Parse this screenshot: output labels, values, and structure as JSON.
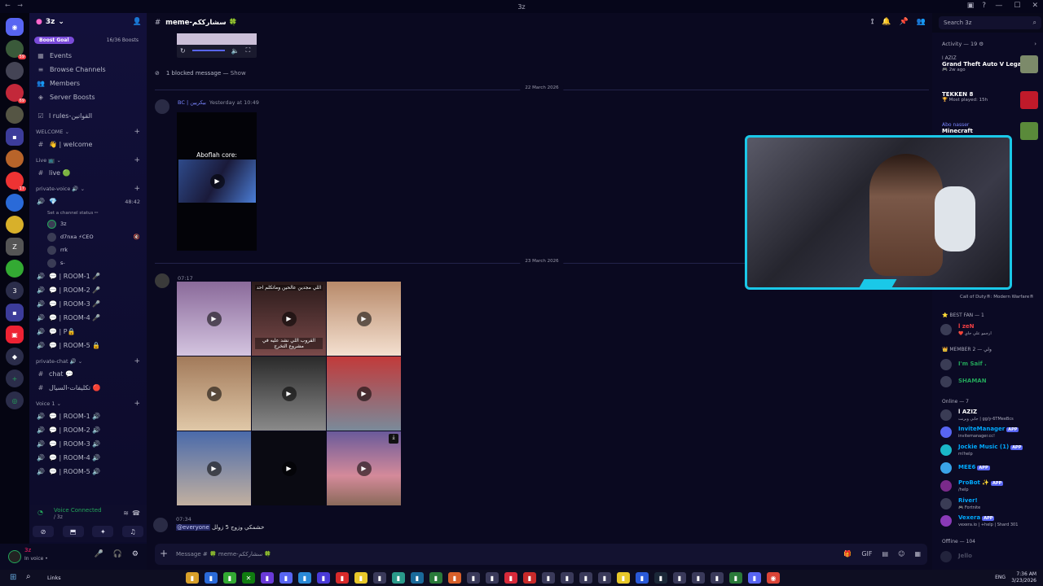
{
  "window": {
    "title": "3z"
  },
  "guild_badges": [
    "",
    "59",
    "",
    "69",
    "",
    "",
    "",
    "17",
    "",
    "3",
    "",
    "",
    ""
  ],
  "server": {
    "name": "3z",
    "boost_label": "Boost Goal",
    "boost_count": "16/36 Boosts"
  },
  "nav": [
    {
      "label": "Events",
      "icon": "calendar-icon"
    },
    {
      "label": "Browse Channels",
      "icon": "browse-icon"
    },
    {
      "label": "Members",
      "icon": "members-icon"
    },
    {
      "label": "Server Boosts",
      "icon": "boost-icon"
    }
  ],
  "rules_channel": "ا rules-القوانين",
  "categories": {
    "welcome": "WELCOME",
    "live": "Live 📺",
    "private_voice": "private-voice 🔊",
    "private_chat": "private-chat 🔊",
    "voice": "Voice 1"
  },
  "channels": {
    "welcome": "👋 | welcome",
    "live": "live 🟢",
    "private_voice_channel": "💎",
    "private_voice_time": "48:42",
    "channel_status": "Set a channel status ✏",
    "voice_users": [
      {
        "name": "3z"
      },
      {
        "name": "d7nxa ⚡CEO"
      },
      {
        "name": "rrk"
      },
      {
        "name": "s-"
      }
    ],
    "rooms": [
      "💬 | ROOM-1 🎤",
      "💬 | ROOM-2 🎤",
      "💬 | ROOM-3 🎤",
      "💬 | ROOM-4 🎤",
      "💬 | P🔒",
      "💬 | ROOM-5 🔒"
    ],
    "chat": [
      "chat 💬",
      "تكليفات-السيال 🔴"
    ],
    "voice_rooms": [
      "💬 | ROOM-1 🔊",
      "💬 | ROOM-2 🔊",
      "💬 | ROOM-3 🔊",
      "💬 | ROOM-4 🔊",
      "💬 | ROOM-5 🔊"
    ]
  },
  "voice_panel": {
    "status": "Voice Connected",
    "sub": "/ 3z"
  },
  "user_panel": {
    "name": "3z",
    "status": "In voice •"
  },
  "channel_header": {
    "name": "meme-سشارككم 🍀"
  },
  "messages": {
    "blocked": "1 blocked message —",
    "blocked_show": "Show",
    "date1": "22 March 2026",
    "author1": "BC | بيكريين",
    "time1": "Yesterday at 10:49",
    "video_title": "Aboflah core:",
    "date2": "23 March 2026",
    "time2": "07:17",
    "captions": [
      "اللي مجدين عالحين وماتكلم احد",
      "القروب اللي نشد عليه في مشروع التخرج"
    ],
    "last_time": "07:34",
    "mention": "@everyone",
    "last_text": "خشمكي وزوج 5 زولل"
  },
  "composer": {
    "placeholder": "Message # 🍀 meme-سشارككم 🍀"
  },
  "search": {
    "placeholder": "Search 3z"
  },
  "activity": {
    "header": "Activity — 19 ⚙",
    "items": [
      {
        "user": "ا AZIZ",
        "game": "Grand Theft Auto V Legacy",
        "time": "🎮 2w ago",
        "color": "#7c8a6a"
      },
      {
        "user": "",
        "game": "TEKKEN 8",
        "time": "🏆 Most played: 15h",
        "color": "#c01a2a"
      },
      {
        "user": "Abo nasser",
        "game": "Minecraft",
        "time": "",
        "color": "#5a8a3a"
      }
    ],
    "cod": "Call of Duty®: Modern Warfare®"
  },
  "member_sections": {
    "best_fan": "⭐ BEST FAN — 1",
    "member": "👑 MEMBER ولي — 2",
    "online": "Online — 7",
    "offline": "Offline — 104"
  },
  "members": {
    "best_fan": [
      {
        "name": "ا zeN",
        "status": "❤️ ارجمو علي جاي"
      }
    ],
    "member": [
      {
        "name": "I'm Saif .",
        "color": "#23a55a"
      },
      {
        "name": "SHAMAN",
        "color": "#23a55a"
      }
    ],
    "online": [
      {
        "name": "ا AZIZ",
        "status": "جابي وبرنت | gg/y-6TMeeBcs",
        "color": "#ffffff",
        "app": ""
      },
      {
        "name": "InviteManager",
        "status": "invitemanager.cc!",
        "color": "#00a8fc",
        "app": "APP"
      },
      {
        "name": "Jockie Music (1)",
        "status": "m!help",
        "color": "#00a8fc",
        "app": "APP"
      },
      {
        "name": "MEE6",
        "status": "",
        "color": "#00a8fc",
        "app": "APP"
      },
      {
        "name": "ProBot ✨",
        "status": "/help",
        "color": "#00a8fc",
        "app": "APP"
      },
      {
        "name": "River!",
        "status": "🎮 Fortnite",
        "color": "#00a8fc",
        "app": ""
      },
      {
        "name": "Vexera",
        "status": "vexera.io | +help | Shard 301",
        "color": "#00a8fc",
        "app": "APP"
      }
    ],
    "offline": [
      {
        "name": "Jello",
        "color": "#8a8da0"
      }
    ]
  },
  "taskbar": {
    "links": "Links",
    "lang": "ENG",
    "time": "7:36 AM",
    "date": "3/23/2026"
  }
}
